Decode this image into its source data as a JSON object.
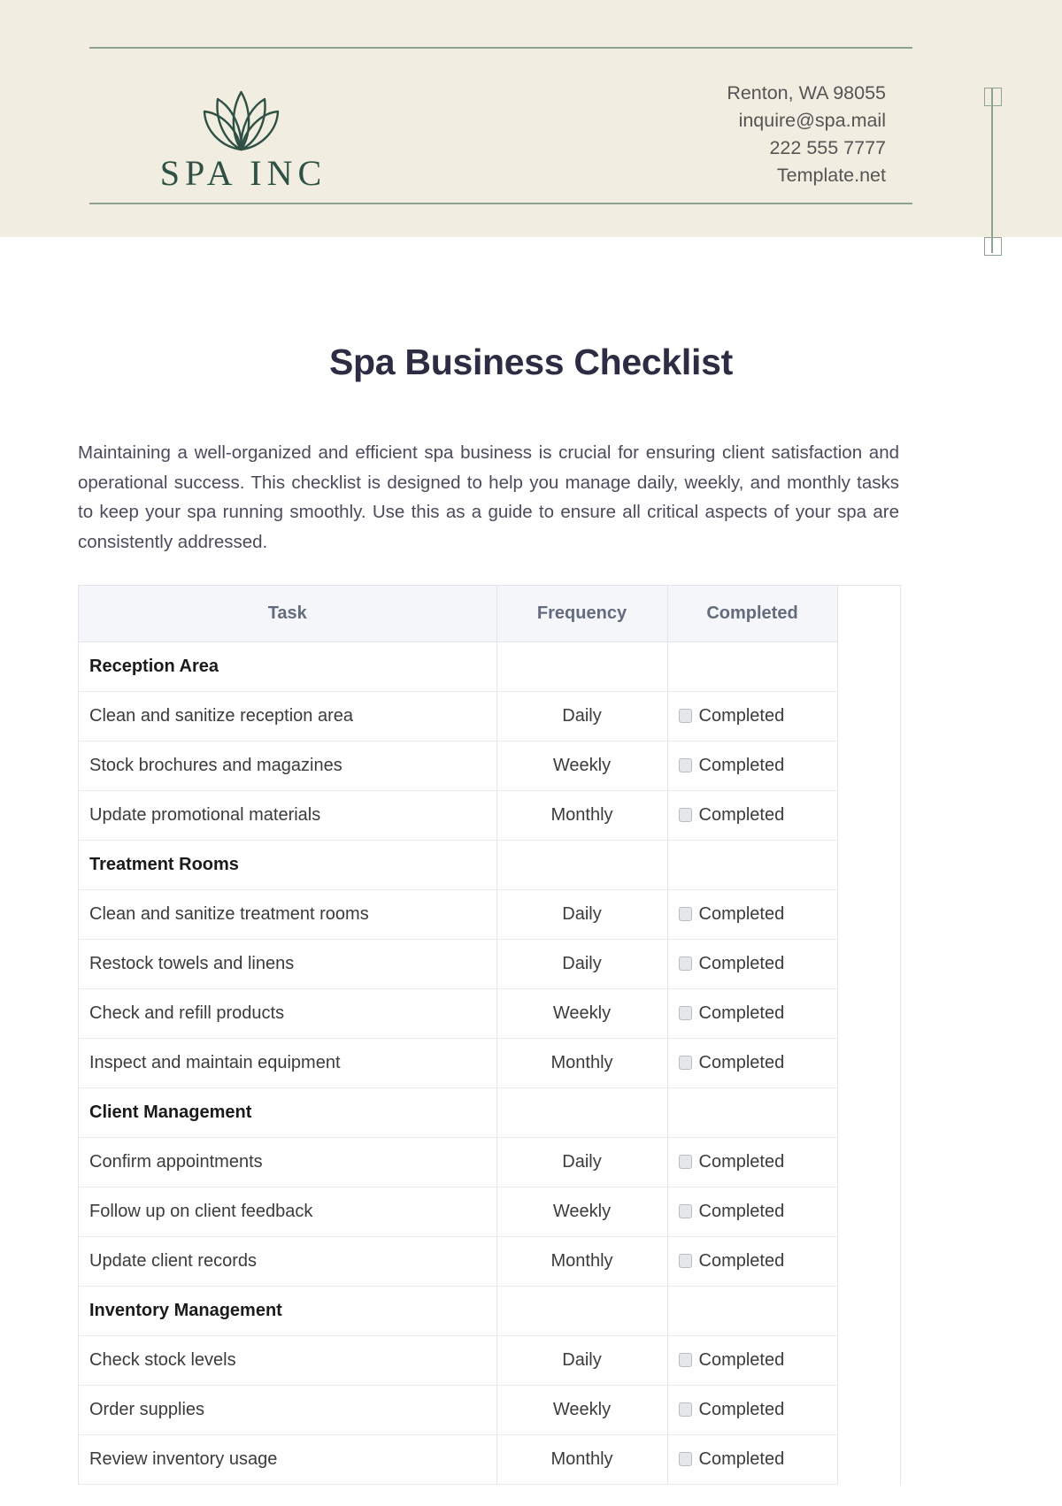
{
  "letterhead": {
    "logo_text": "SPA INC",
    "logo_icon": "lotus-flower-icon",
    "contact": [
      "Renton, WA 98055",
      "inquire@spa.mail",
      "222 555 7777",
      "Template.net"
    ],
    "accent_color": "#8FA394",
    "background_color": "#F2EDE1",
    "logo_color": "#2E5045"
  },
  "document": {
    "title": "Spa Business Checklist",
    "intro": "Maintaining a well-organized and efficient spa business is crucial for ensuring client satisfaction and operational success. This checklist is designed to help you manage daily, weekly, and monthly tasks to keep your spa running smoothly. Use this as a guide to ensure all critical aspects of your spa are consistently addressed.",
    "title_color": "#2C2C42"
  },
  "table": {
    "headers": [
      "Task",
      "Frequency",
      "Completed"
    ],
    "completed_label": "Completed",
    "rows": [
      {
        "type": "section",
        "task": "Reception Area",
        "frequency": "",
        "completed": false
      },
      {
        "type": "task",
        "task": "Clean and sanitize reception area",
        "frequency": "Daily",
        "completed": false
      },
      {
        "type": "task",
        "task": "Stock brochures and magazines",
        "frequency": "Weekly",
        "completed": false
      },
      {
        "type": "task",
        "task": "Update promotional materials",
        "frequency": "Monthly",
        "completed": false
      },
      {
        "type": "section",
        "task": "Treatment Rooms",
        "frequency": "",
        "completed": false
      },
      {
        "type": "task",
        "task": "Clean and sanitize treatment rooms",
        "frequency": "Daily",
        "completed": false
      },
      {
        "type": "task",
        "task": "Restock towels and linens",
        "frequency": "Daily",
        "completed": false
      },
      {
        "type": "task",
        "task": "Check and refill products",
        "frequency": "Weekly",
        "completed": false
      },
      {
        "type": "task",
        "task": "Inspect and maintain equipment",
        "frequency": "Monthly",
        "completed": false
      },
      {
        "type": "section",
        "task": "Client Management",
        "frequency": "",
        "completed": false
      },
      {
        "type": "task",
        "task": "Confirm appointments",
        "frequency": "Daily",
        "completed": false
      },
      {
        "type": "task",
        "task": "Follow up on client feedback",
        "frequency": "Weekly",
        "completed": false
      },
      {
        "type": "task",
        "task": "Update client records",
        "frequency": "Monthly",
        "completed": false
      },
      {
        "type": "section",
        "task": "Inventory Management",
        "frequency": "",
        "completed": false
      },
      {
        "type": "task",
        "task": "Check stock levels",
        "frequency": "Daily",
        "completed": false
      },
      {
        "type": "task",
        "task": "Order supplies",
        "frequency": "Weekly",
        "completed": false
      },
      {
        "type": "task",
        "task": "Review inventory usage",
        "frequency": "Monthly",
        "completed": false
      }
    ]
  }
}
